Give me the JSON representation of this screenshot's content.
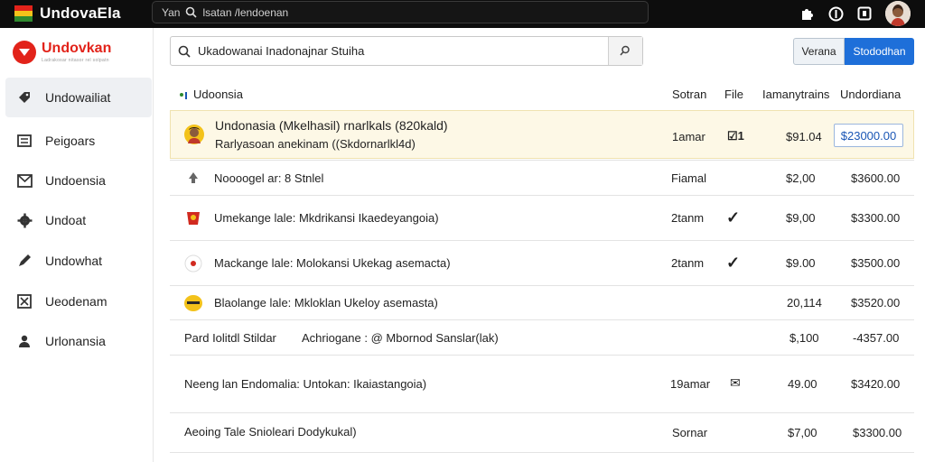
{
  "topbar": {
    "brand": "UndovaEla",
    "search_prefix": "Yan",
    "search_text": "lsatan /lendoenan"
  },
  "sidebar": {
    "logo_name": "Undovkan",
    "logo_sub": "Ladrakosar nitasor rel solpatn",
    "items": [
      {
        "label": "Undowailiat",
        "icon": "tag-icon",
        "active": true
      },
      {
        "label": "Peigoars",
        "icon": "list-icon",
        "active": false
      },
      {
        "label": "Undoensia",
        "icon": "mail-icon",
        "active": false
      },
      {
        "label": "Undoat",
        "icon": "gear-icon",
        "active": false
      },
      {
        "label": "Undowhat",
        "icon": "pen-icon",
        "active": false
      },
      {
        "label": "Ueodenam",
        "icon": "checkbox-icon",
        "active": false
      },
      {
        "label": "Urlonansia",
        "icon": "user-icon",
        "active": false
      }
    ]
  },
  "search": {
    "value": "Ukadowanai Inadonajnar Stuiha"
  },
  "actions": {
    "secondary": "Verana",
    "primary": "Stododhan"
  },
  "table": {
    "title": "Udoonsia",
    "columns": [
      "Sotran",
      "File",
      "Iamanytrains",
      "Undordiana"
    ],
    "rows": [
      {
        "title": "Undonasia (Mkelhasil) rnarlkals (820kald)",
        "subtitle": "Rarlyasoan anekinam ((Skdornarlkl4d)",
        "sotran": "1amar",
        "file": "☑1",
        "price": "$91.04",
        "total": "$23000.00"
      },
      {
        "title": "Noooogel ar: 8 Stnlel",
        "sotran": "Fiamal",
        "file": "",
        "price": "$2,00",
        "total": "$3600.00"
      },
      {
        "title": "Umekange lale: Mkdrikansi Ikaedeyangoia)",
        "sotran": "2tanm",
        "file": "✓",
        "price": "$9,00",
        "total": "$3300.00"
      },
      {
        "title": "Mackange lale: Molokansi Ukekag asemacta)",
        "sotran": "2tanm",
        "file": "✓",
        "price": "$9.00",
        "total": "$3500.00"
      },
      {
        "title": "Blaolange lale: Mkloklan Ukeloy asemasta)",
        "sotran": "",
        "file": "",
        "price": "20,114",
        "total": "$3520.00"
      },
      {
        "title": "Pard Iolitdl Stildar",
        "extra": "Achriogane : @ Mbornod Sanslar(lak)",
        "sotran": "",
        "file": "",
        "price": "$,100",
        "total": "-4357.00"
      },
      {
        "title": "Neeng lan Endomalia: Untokan: Ikaiastangoia)",
        "sotran": "19amar",
        "file": "✉",
        "price": "49.00",
        "total": "$3420.00"
      },
      {
        "title": "Aeoing Tale Snioleari Dodykukal)",
        "sotran": "Sornar",
        "file": "",
        "price": "$7,00",
        "total": "$3300.00"
      }
    ]
  }
}
